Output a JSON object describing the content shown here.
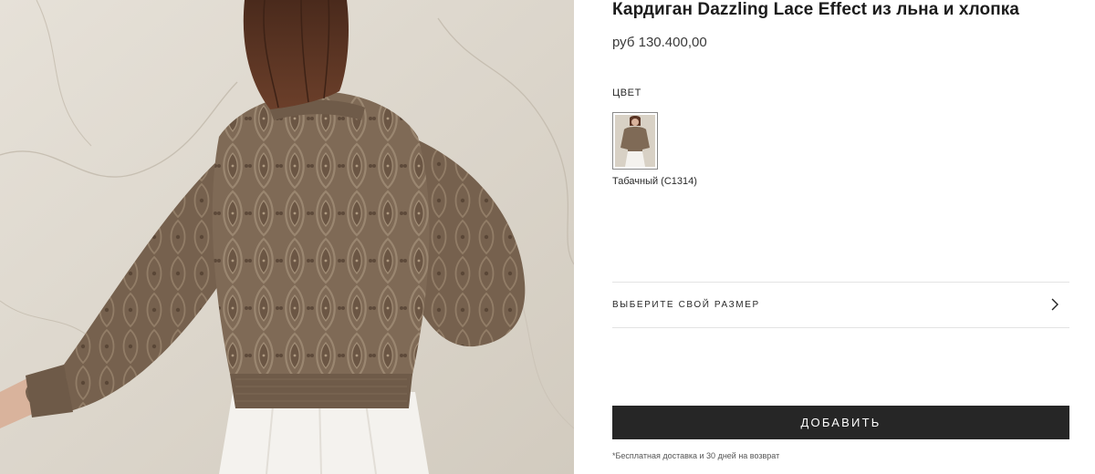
{
  "product": {
    "title": "Кардиган Dazzling Lace Effect из льна и хлопка",
    "price": "руб 130.400,00"
  },
  "color_section": {
    "label": "ЦВЕТ",
    "selected_swatch": "Табачный (C1314)"
  },
  "size_selector": {
    "label": "ВЫБЕРИТЕ СВОЙ РАЗМЕР",
    "icon": "chevron-right-icon"
  },
  "cart": {
    "add_label": "ДОБАВИТЬ"
  },
  "delivery_note": "*Бесплатная доставка и 30 дней на возврат",
  "colors": {
    "button_bg": "#262626",
    "button_text": "#ffffff",
    "cardigan": "#7f6a56",
    "skirt": "#f4f2ee",
    "hair": "#5a3525"
  }
}
